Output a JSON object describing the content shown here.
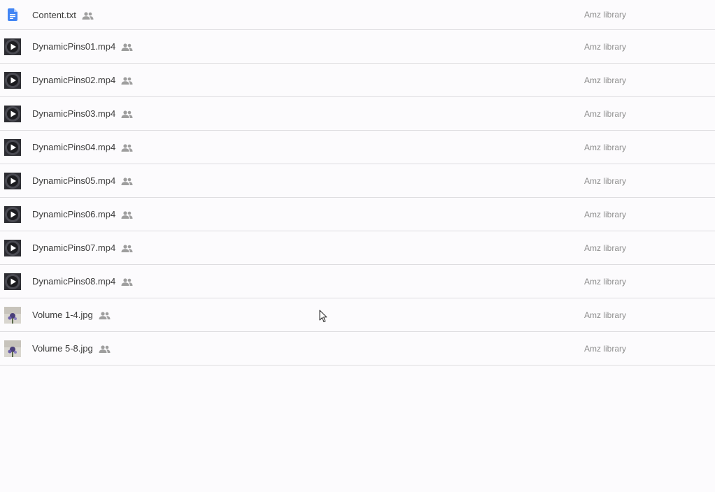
{
  "files": [
    {
      "name": "Content.txt",
      "type": "doc",
      "icon": "document-icon",
      "shared_icon": "shared-people-icon",
      "location": "Amz library"
    },
    {
      "name": "DynamicPins01.mp4",
      "type": "video",
      "icon": "video-thumbnail-icon",
      "shared_icon": "shared-people-icon",
      "location": "Amz library"
    },
    {
      "name": "DynamicPins02.mp4",
      "type": "video",
      "icon": "video-thumbnail-icon",
      "shared_icon": "shared-people-icon",
      "location": "Amz library"
    },
    {
      "name": "DynamicPins03.mp4",
      "type": "video",
      "icon": "video-thumbnail-icon",
      "shared_icon": "shared-people-icon",
      "location": "Amz library"
    },
    {
      "name": "DynamicPins04.mp4",
      "type": "video",
      "icon": "video-thumbnail-icon",
      "shared_icon": "shared-people-icon",
      "location": "Amz library"
    },
    {
      "name": "DynamicPins05.mp4",
      "type": "video",
      "icon": "video-thumbnail-icon",
      "shared_icon": "shared-people-icon",
      "location": "Amz library"
    },
    {
      "name": "DynamicPins06.mp4",
      "type": "video",
      "icon": "video-thumbnail-icon",
      "shared_icon": "shared-people-icon",
      "location": "Amz library"
    },
    {
      "name": "DynamicPins07.mp4",
      "type": "video",
      "icon": "video-thumbnail-icon",
      "shared_icon": "shared-people-icon",
      "location": "Amz library"
    },
    {
      "name": "DynamicPins08.mp4",
      "type": "video",
      "icon": "video-thumbnail-icon",
      "shared_icon": "shared-people-icon",
      "location": "Amz library"
    },
    {
      "name": "Volume 1-4.jpg",
      "type": "image",
      "icon": "image-thumbnail-icon",
      "shared_icon": "shared-people-icon",
      "location": "Amz library"
    },
    {
      "name": "Volume 5-8.jpg",
      "type": "image",
      "icon": "image-thumbnail-icon",
      "shared_icon": "shared-people-icon",
      "location": "Amz library"
    }
  ],
  "colors": {
    "background": "#fcfbfd",
    "divider": "#dedde0",
    "doc_icon": "#4285f4",
    "text": "#3c3c3c",
    "secondary_text": "#8e8e8e"
  }
}
